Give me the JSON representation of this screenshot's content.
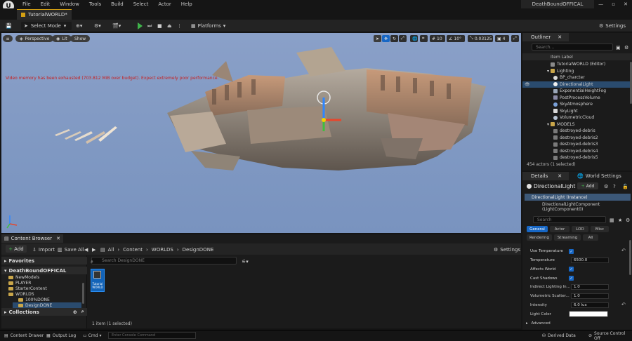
{
  "titlebar": {
    "menu": [
      "File",
      "Edit",
      "Window",
      "Tools",
      "Build",
      "Select",
      "Actor",
      "Help"
    ],
    "project": "DeathBoundOFFICAL",
    "level_tab": "TutorialWORLD*"
  },
  "toolbar": {
    "select_mode": "Select Mode",
    "platforms": "Platforms",
    "settings": "Settings"
  },
  "viewport": {
    "perspective": "Perspective",
    "lit": "Lit",
    "show": "Show",
    "grid_value": "10",
    "angle_value": "10°",
    "scale_value": "0.03125",
    "camera_speed": "4",
    "warning": "Video memory has been exhausted (703.812 MiB over budget). Expect extremely poor performance."
  },
  "content_browser": {
    "tab": "Content Browser",
    "add": "Add",
    "import": "Import",
    "save_all": "Save All",
    "breadcrumb": [
      "All",
      "Content",
      "WORLDS",
      "DesignDONE"
    ],
    "settings": "Settings",
    "favorites": "Favorites",
    "root": "DeathBoundOFFICAL",
    "tree": [
      "NewModels",
      "PLAYER",
      "StarterContent",
      "WORLDS",
      "100%DONE",
      "DesignDONE"
    ],
    "collections": "Collections",
    "search_placeholder": "Search DesignDONE",
    "asset_label": "Tutorial WORLD",
    "count": "1 item (1 selected)"
  },
  "statusbar": {
    "content_drawer": "Content Drawer",
    "output_log": "Output Log",
    "cmd": "Cmd",
    "console_placeholder": "Enter Console Command",
    "derived_data": "Derived Data",
    "source_control": "Source Control Off"
  },
  "outliner": {
    "tab": "Outliner",
    "search_placeholder": "Search...",
    "column": "Item Label",
    "items": [
      {
        "label": "TutorialWORLD (Editor)",
        "indent": 0,
        "type": "world"
      },
      {
        "label": "Lighting",
        "indent": 1,
        "type": "folder"
      },
      {
        "label": "BP_charcter",
        "indent": 2,
        "type": "actor"
      },
      {
        "label": "DirectionalLight",
        "indent": 2,
        "type": "light",
        "selected": true
      },
      {
        "label": "ExponentialHeightFog",
        "indent": 2,
        "type": "actor"
      },
      {
        "label": "PostProcessVolume",
        "indent": 2,
        "type": "actor"
      },
      {
        "label": "SkyAtmosphere",
        "indent": 2,
        "type": "actor"
      },
      {
        "label": "SkyLight",
        "indent": 2,
        "type": "actor"
      },
      {
        "label": "VolumetricCloud",
        "indent": 2,
        "type": "actor"
      },
      {
        "label": "MODELS",
        "indent": 1,
        "type": "folder"
      },
      {
        "label": "destroyed-debris",
        "indent": 2,
        "type": "mesh"
      },
      {
        "label": "destroyed-debris2",
        "indent": 2,
        "type": "mesh"
      },
      {
        "label": "destroyed-debris3",
        "indent": 2,
        "type": "mesh"
      },
      {
        "label": "destroyed-debris4",
        "indent": 2,
        "type": "mesh"
      },
      {
        "label": "destroyed-debris5",
        "indent": 2,
        "type": "mesh"
      }
    ],
    "footer": "454 actors (1 selected)"
  },
  "details": {
    "tab": "Details",
    "world_settings_tab": "World Settings",
    "title": "DirectionalLight",
    "add": "Add",
    "instance": "DirectionalLight (Instance)",
    "component": "DirectionalLightComponent (LightComponent0)",
    "search_placeholder": "Search",
    "categories_row1": [
      "General",
      "Actor",
      "LOD",
      "Misc"
    ],
    "categories_row2": [
      "Rendering",
      "Streaming",
      "All"
    ],
    "properties": {
      "use_temperature": "Use Temperature",
      "temperature": "Temperature",
      "temperature_value": "6500.0",
      "affects_world": "Affects World",
      "cast_shadows": "Cast Shadows",
      "indirect": "Indirect Lighting In...",
      "indirect_value": "1.0",
      "volumetric": "Volumetric Scatter...",
      "volumetric_value": "1.0",
      "intensity": "Intensity",
      "intensity_value": "6.0 lux",
      "light_color": "Light Color",
      "advanced": "Advanced"
    }
  }
}
